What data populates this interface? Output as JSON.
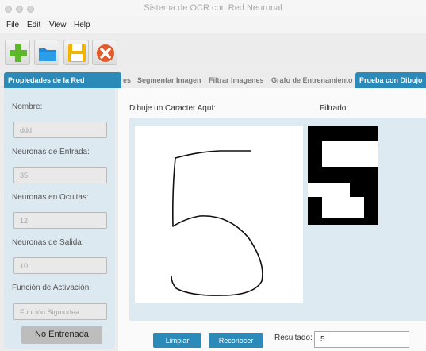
{
  "window": {
    "title": "Sistema de OCR con Red Neuronal"
  },
  "menu": [
    "File",
    "Edit",
    "View",
    "Help"
  ],
  "toolbar": {
    "buttons": [
      {
        "icon": "add-icon",
        "color": "#5cb82a"
      },
      {
        "icon": "folder-icon",
        "color": "#1e8ad6"
      },
      {
        "icon": "save-icon",
        "color": "#f3b400"
      },
      {
        "icon": "close-icon",
        "color": "#e25b2a"
      }
    ]
  },
  "side_panel": {
    "tab_label": "Propiedades de la Red",
    "fields": [
      {
        "label": "Nombre:",
        "value": "ddd"
      },
      {
        "label": "Neuronas de Entrada:",
        "value": "35"
      },
      {
        "label": "Neuronas en Ocultas:",
        "value": "12"
      },
      {
        "label": "Neuronas de Salida:",
        "value": "10"
      },
      {
        "label": "Función de Activación:",
        "value": "Función Sigmodea"
      }
    ],
    "status": "No Entrenada"
  },
  "tabs": [
    {
      "label": "es",
      "active": false
    },
    {
      "label": "Segmentar Imagen",
      "active": false
    },
    {
      "label": "Filtrar Imagenes",
      "active": false
    },
    {
      "label": "Grafo de Entrenamiento",
      "active": false
    },
    {
      "label": "Prueba con Dibujo",
      "active": true
    }
  ],
  "main": {
    "draw_label": "Dibuje un Caracter Aquí:",
    "filtered_label": "Filtrado:",
    "clear_button": "Limpiar",
    "recognize_button": "Reconocer",
    "result_label": "Resultado:",
    "result_value": "5"
  },
  "colors": {
    "accent": "#2c8ab8",
    "panel": "#dde9f1"
  }
}
